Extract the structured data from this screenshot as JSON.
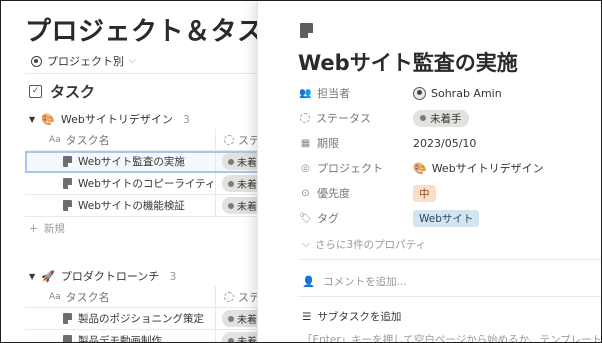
{
  "database": {
    "title": "プロジェクト＆タスク",
    "view_tab": "プロジェクト別",
    "section_title": "タスク",
    "columns": {
      "name": "タスク名",
      "status": "ステータス"
    },
    "new_label": "新規",
    "groups": [
      {
        "emoji": "🎨",
        "name": "Webサイトリデザイン",
        "count": "3",
        "rows": [
          {
            "name": "Webサイト監査の実施",
            "status": "未着手"
          },
          {
            "name": "Webサイトのコピーライティング",
            "status": "未着手"
          },
          {
            "name": "Webサイトの機能検証",
            "status": "未着手"
          }
        ]
      },
      {
        "emoji": "🚀",
        "name": "プロダクトローンチ",
        "count": "3",
        "rows": [
          {
            "name": "製品のポジショニング策定",
            "status": "未着手"
          },
          {
            "name": "製品デモ動画制作",
            "status": "未着手"
          }
        ]
      }
    ]
  },
  "peek": {
    "title": "Webサイト監査の実施",
    "properties": {
      "assignee": {
        "label": "担当者",
        "value": "Sohrab Amin"
      },
      "status": {
        "label": "ステータス",
        "value": "未着手"
      },
      "due": {
        "label": "期限",
        "value": "2023/05/10"
      },
      "project": {
        "label": "プロジェクト",
        "emoji": "🎨",
        "value": "Webサイトリデザイン"
      },
      "priority": {
        "label": "優先度",
        "value": "中"
      },
      "tags": {
        "label": "タグ",
        "value": "Webサイト"
      }
    },
    "more_properties": "さらに3件のプロパティ",
    "comment_placeholder": "コメントを追加...",
    "add_subtask": "サブタスクを追加",
    "hint": "「Enter」キーを押して空白ページから始めるか、テンプレートを"
  },
  "colors": {
    "status_grey": "#e3e2e0",
    "priority_orange": "#fadec9",
    "tag_blue": "#d3e5ef",
    "selection": "#a8c7ee"
  }
}
